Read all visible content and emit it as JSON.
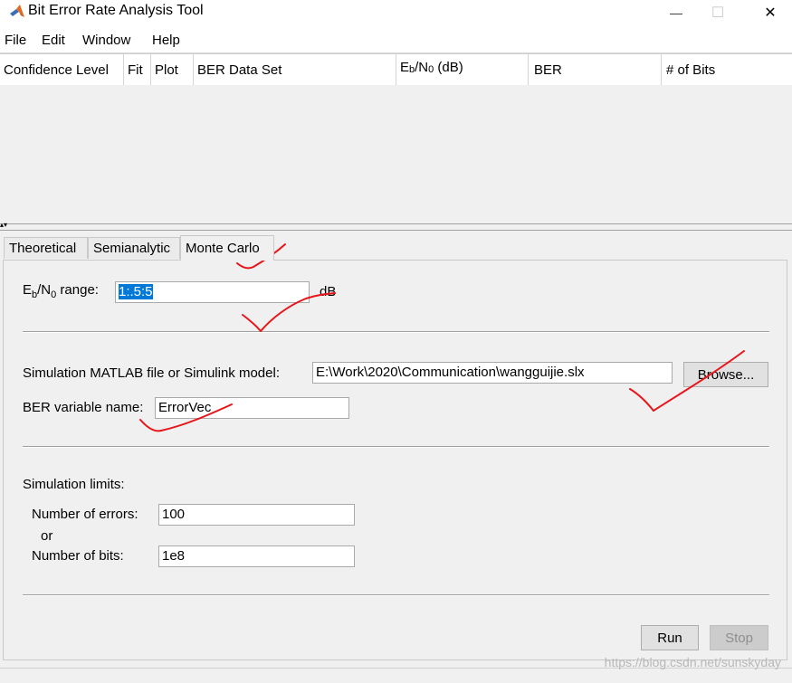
{
  "window": {
    "title": "Bit Error Rate Analysis Tool",
    "controls": {
      "minimize": "—",
      "maximize": "☐",
      "close": "✕"
    },
    "icon": "matlab-icon"
  },
  "menu": [
    "File",
    "Edit",
    "Window",
    "Help"
  ],
  "table": {
    "columns": [
      "Confidence Level",
      "Fit",
      "Plot",
      "BER Data Set",
      "E",
      "b",
      "/N",
      "0",
      " (dB)",
      "BER",
      "# of Bits"
    ]
  },
  "tabs": {
    "theoretical": "Theoretical",
    "semianalytic": "Semianalytic",
    "montecarlo": "Monte Carlo",
    "active": "Monte Carlo"
  },
  "montecarlo": {
    "range_label": {
      "e": "E",
      "b": "b",
      "n": "/N",
      "zero": "0",
      "rest": " range:"
    },
    "range_value": "1:.5:5",
    "range_unit": "dB",
    "sim_label": "Simulation MATLAB file or Simulink model:",
    "sim_value": "E:\\Work\\2020\\Communication\\wangguijie.slx",
    "browse": "Browse...",
    "ber_label": "BER variable name:",
    "ber_value": "ErrorVec",
    "limits_label": "Simulation limits:",
    "errors_label": "Number of errors:",
    "errors_value": "100",
    "or_label": "or",
    "bits_label": "Number of bits:",
    "bits_value": "1e8",
    "run": "Run",
    "stop": "Stop"
  },
  "watermark": "https://blog.csdn.net/sunskyday",
  "colors": {
    "annotation": "#e8141a",
    "selection": "#0078d7"
  }
}
